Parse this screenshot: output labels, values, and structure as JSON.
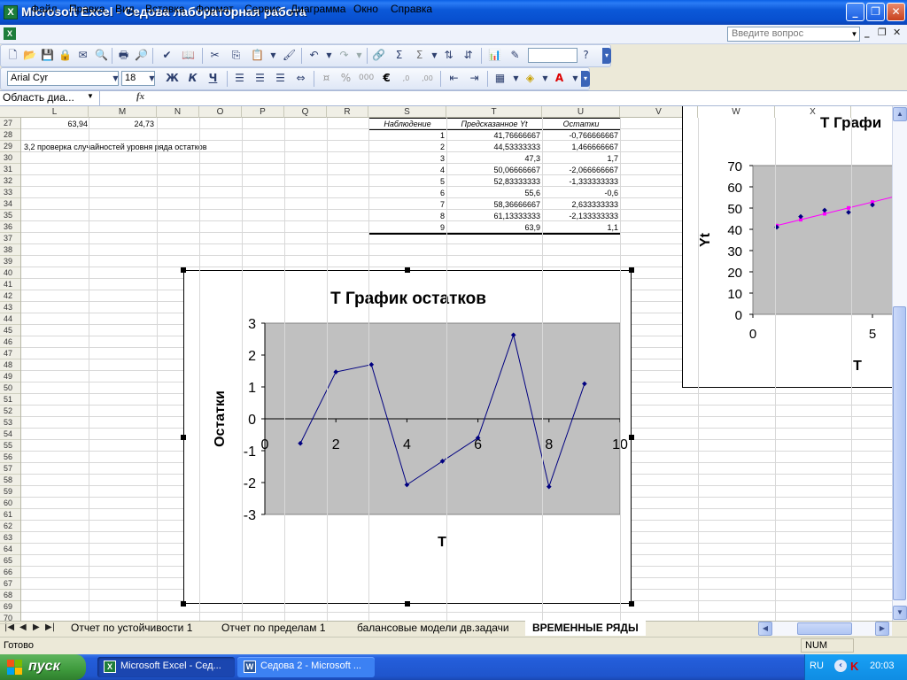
{
  "window": {
    "title": "Microsoft Excel - Седова лабораторная работа",
    "minimize": "_",
    "restore": "❐",
    "close": "✕"
  },
  "menu": {
    "items": [
      "Файл",
      "Правка",
      "Вид",
      "Вставка",
      "Формат",
      "Сервис",
      "Диаграмма",
      "Окно",
      "Справка"
    ],
    "help_placeholder": "Введите вопрос"
  },
  "format_toolbar": {
    "font": "Arial Cyr",
    "size": "18",
    "bold": "Ж",
    "italic": "К",
    "underline": "Ч"
  },
  "formula_bar": {
    "name_box": "Область диа...",
    "fx": "fx"
  },
  "columns": [
    "L",
    "M",
    "N",
    "O",
    "P",
    "Q",
    "R",
    "S",
    "T",
    "U",
    "V",
    "W",
    "X"
  ],
  "rows": [
    "27",
    "28",
    "29",
    "30",
    "31",
    "32",
    "33",
    "34",
    "35",
    "36",
    "37",
    "38",
    "39",
    "40",
    "41",
    "42",
    "43",
    "44",
    "45",
    "46",
    "47",
    "48",
    "49",
    "50",
    "51",
    "52",
    "53",
    "54",
    "55",
    "56",
    "57",
    "58",
    "59",
    "60",
    "61",
    "62",
    "63",
    "64",
    "65",
    "66",
    "67",
    "68",
    "69",
    "70"
  ],
  "cells": {
    "l27": "63,94",
    "m27": "24,73",
    "note29": "3,2 проверка случайностей уровня ряда остатков"
  },
  "residual_table": {
    "headers": [
      "Наблюдение",
      "Предсказанное Yt",
      "Остатки"
    ],
    "rows": [
      [
        "1",
        "41,76666667",
        "-0,766666667"
      ],
      [
        "2",
        "44,53333333",
        "1,466666667"
      ],
      [
        "3",
        "47,3",
        "1,7"
      ],
      [
        "4",
        "50,06666667",
        "-2,066666667"
      ],
      [
        "5",
        "52,83333333",
        "-1,333333333"
      ],
      [
        "6",
        "55,6",
        "-0,6"
      ],
      [
        "7",
        "58,36666667",
        "2,633333333"
      ],
      [
        "8",
        "61,13333333",
        "-2,133333333"
      ],
      [
        "9",
        "63,9",
        "1,1"
      ]
    ]
  },
  "chart_data": [
    {
      "type": "line",
      "title": "T График остатков",
      "xlabel": "T",
      "ylabel": "Остатки",
      "xlim": [
        0,
        10
      ],
      "ylim": [
        -3,
        3
      ],
      "xticks": [
        "0",
        "2",
        "4",
        "6",
        "8",
        "10"
      ],
      "yticks": [
        "3",
        "2",
        "1",
        "0",
        "-1",
        "-2",
        "-3"
      ],
      "x": [
        1,
        2,
        3,
        4,
        5,
        6,
        7,
        8,
        9
      ],
      "series": [
        {
          "values": [
            -0.77,
            1.47,
            1.7,
            -2.07,
            -1.33,
            -0.6,
            2.63,
            -2.13,
            1.1
          ],
          "color": "#000080"
        }
      ],
      "plot_bg": "#c0c0c0",
      "grid": false
    },
    {
      "type": "scatter",
      "title": "T Графи",
      "xlabel": "T",
      "ylabel": "Yt",
      "xlim": [
        0,
        7
      ],
      "ylim": [
        0,
        70
      ],
      "xticks": [
        "0",
        "5"
      ],
      "yticks": [
        "70",
        "60",
        "50",
        "40",
        "30",
        "20",
        "10",
        "0"
      ],
      "x": [
        1,
        2,
        3,
        4,
        5,
        6
      ],
      "series": [
        {
          "values": [
            41,
            46,
            49,
            48,
            51.5,
            55
          ],
          "color": "#000080"
        },
        {
          "values": [
            41.77,
            44.53,
            47.3,
            50.07,
            52.83,
            55.6
          ],
          "color": "#ff00ff"
        }
      ],
      "plot_bg": "#c0c0c0",
      "grid": false
    }
  ],
  "sheet_tabs": {
    "tabs": [
      "Отчет по устойчивости 1",
      "Отчет по пределам 1",
      "балансовые модели дв.задачи",
      "ВРЕМЕННЫЕ РЯДЫ"
    ],
    "active": "ВРЕМЕННЫЕ РЯДЫ"
  },
  "status": {
    "text": "Готово",
    "num": "NUM"
  },
  "taskbar": {
    "start": "пуск",
    "tasks": [
      "Microsoft Excel - Сед...",
      "Седова 2 - Microsoft ..."
    ],
    "lang": "RU",
    "clock": "20:03"
  }
}
